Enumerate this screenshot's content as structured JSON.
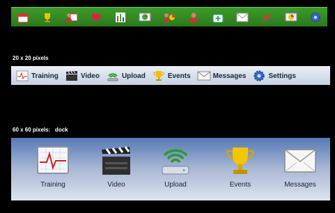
{
  "strip_icons": [
    "calendar-icon",
    "trophy-icon",
    "person-calendar-icon",
    "heart-icon",
    "bar-chart-icon",
    "pie-chart-monitor-icon",
    "users-pie-icon",
    "person-icon",
    "medical-kit-icon",
    "mail-icon",
    "pin-icon",
    "monitor-pie-icon",
    "gear-icon"
  ],
  "section_small": {
    "caption": "20 x 20 pixels"
  },
  "toolbar": {
    "items": [
      {
        "label": "Training",
        "icon": "heartbeat-monitor-icon"
      },
      {
        "label": "Video",
        "icon": "clapperboard-icon"
      },
      {
        "label": "Upload",
        "icon": "wifi-upload-icon"
      },
      {
        "label": "Events",
        "icon": "trophy-icon"
      },
      {
        "label": "Messages",
        "icon": "envelope-icon"
      },
      {
        "label": "Settings",
        "icon": "gear-icon"
      }
    ]
  },
  "section_dock": {
    "caption": "60 x 60 pixels:   dock"
  },
  "dock": {
    "items": [
      {
        "label": "Training",
        "icon": "heartbeat-monitor-icon"
      },
      {
        "label": "Video",
        "icon": "clapperboard-icon"
      },
      {
        "label": "Upload",
        "icon": "wifi-upload-icon"
      },
      {
        "label": "Events",
        "icon": "trophy-icon"
      },
      {
        "label": "Messages",
        "icon": "envelope-icon"
      }
    ]
  },
  "colors": {
    "strip": "#2f8420",
    "toolbar": "#d3dbe8",
    "dock_top": "#5679b6"
  }
}
